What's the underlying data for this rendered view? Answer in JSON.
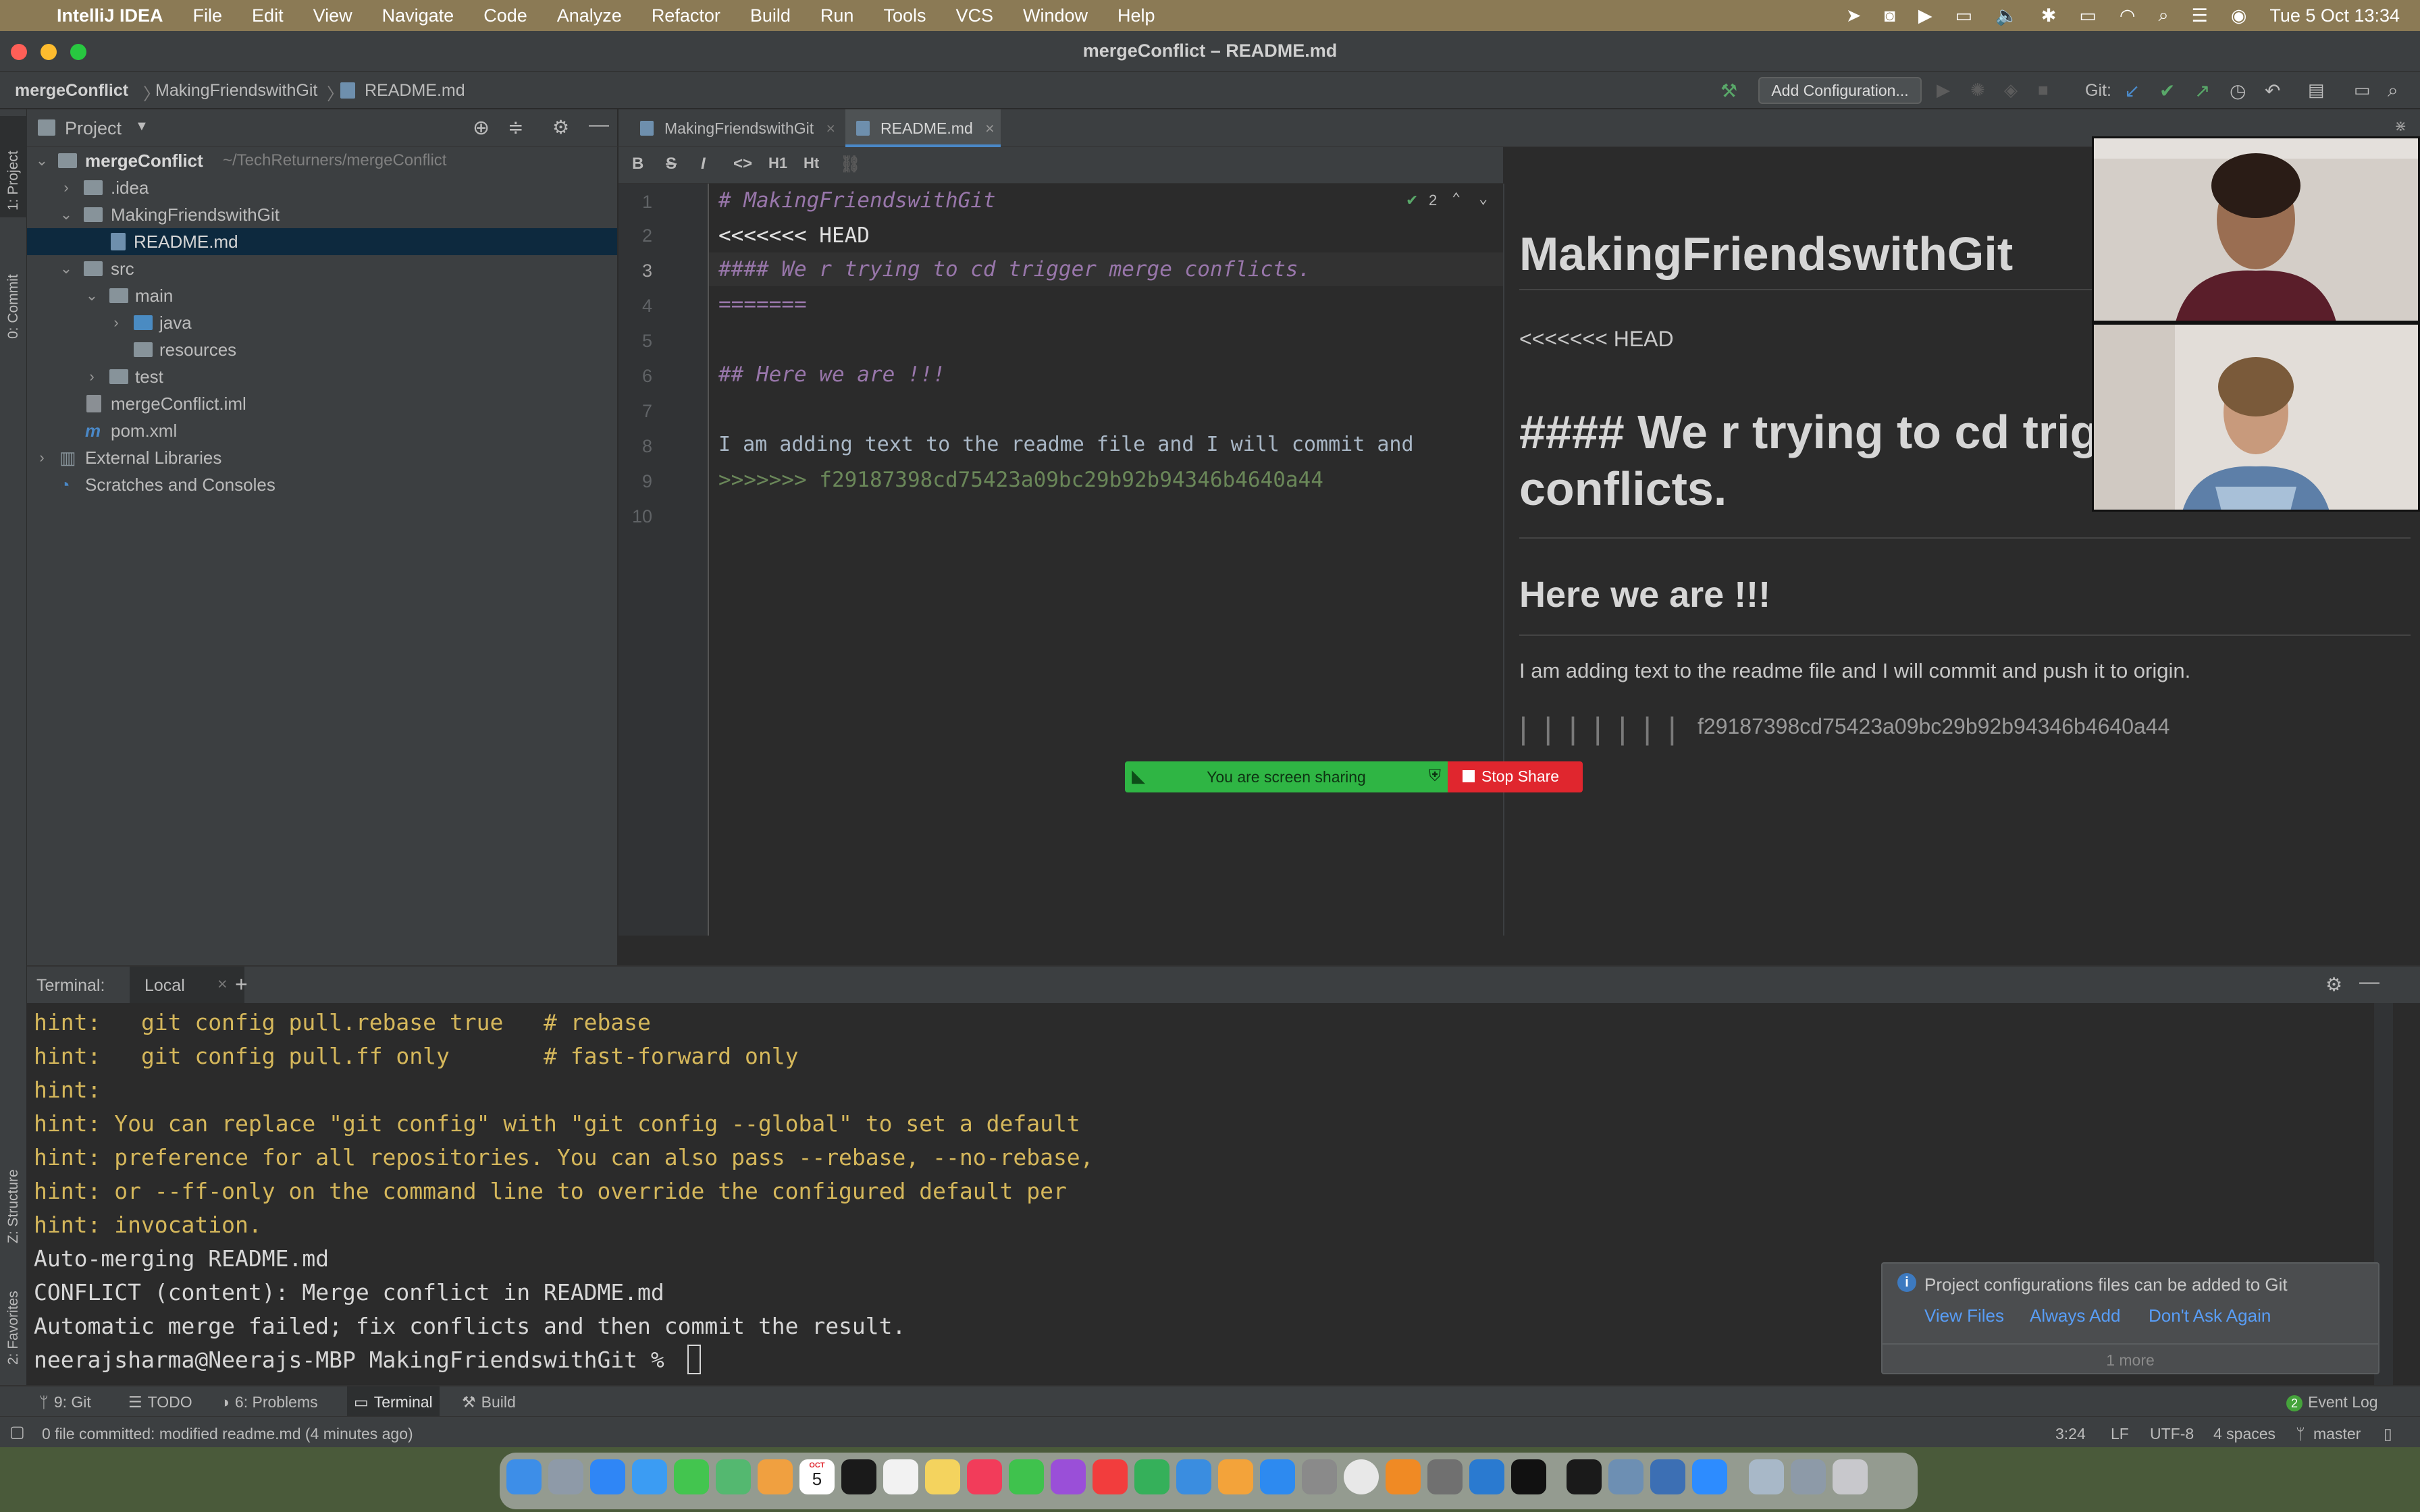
{
  "menubar": {
    "app_name": "IntelliJ IDEA",
    "items": [
      "File",
      "Edit",
      "View",
      "Navigate",
      "Code",
      "Analyze",
      "Refactor",
      "Build",
      "Run",
      "Tools",
      "VCS",
      "Window",
      "Help"
    ],
    "datetime": "Tue 5 Oct  13:34"
  },
  "window": {
    "title": "mergeConflict – README.md"
  },
  "navbar": {
    "breadcrumbs": [
      "mergeConflict",
      "MakingFriendswithGit",
      "README.md"
    ],
    "add_configuration": "Add Configuration...",
    "git_label": "Git:"
  },
  "left_stripe": {
    "project": "1: Project",
    "commit": "0: Commit",
    "structure": "Z: Structure",
    "favorites": "2: Favorites"
  },
  "project_panel": {
    "title": "Project",
    "tree": [
      {
        "label": "mergeConflict",
        "path": "~/TechReturners/mergeConflict"
      },
      {
        "label": ".idea"
      },
      {
        "label": "MakingFriendswithGit"
      },
      {
        "label": "README.md"
      },
      {
        "label": "src"
      },
      {
        "label": "main"
      },
      {
        "label": "java"
      },
      {
        "label": "resources"
      },
      {
        "label": "test"
      },
      {
        "label": "mergeConflict.iml"
      },
      {
        "label": "pom.xml"
      },
      {
        "label": "External Libraries"
      },
      {
        "label": "Scratches and Consoles"
      }
    ]
  },
  "editor": {
    "tabs": [
      {
        "label": "MakingFriendswithGit",
        "active": false
      },
      {
        "label": "README.md",
        "active": true
      }
    ],
    "toolbar": [
      "B",
      "S",
      "I",
      "<>",
      "H1",
      "Ht"
    ],
    "inspection_count": "2",
    "lines": [
      {
        "n": "1",
        "text": "# MakingFriendswithGit"
      },
      {
        "n": "2",
        "text": "<<<<<<< HEAD"
      },
      {
        "n": "3",
        "text": "#### We r trying to cd trigger merge conflicts."
      },
      {
        "n": "4",
        "text": "======="
      },
      {
        "n": "5",
        "text": ""
      },
      {
        "n": "6",
        "text": "## Here we are !!!"
      },
      {
        "n": "7",
        "text": ""
      },
      {
        "n": "8",
        "text": "I am adding text to the readme file and I will commit and"
      },
      {
        "n": "9",
        "text": ">>>>>>> f29187398cd75423a09bc29b92b94346b4640a44"
      },
      {
        "n": "10",
        "text": ""
      }
    ]
  },
  "preview": {
    "h1": "MakingFriendswithGit",
    "head_marker": "<<<<<<< HEAD",
    "h4_line1": "#### We r trying to cd trig",
    "h4_line2": "conflicts.",
    "h2": "Here we are !!!",
    "para": "I am adding text to the readme file and I will commit and push it to origin.",
    "marker_bars": "| | | | | | |",
    "hash": "f29187398cd75423a09bc29b92b94346b4640a44"
  },
  "screen_share": {
    "status": "You are screen sharing",
    "stop": "Stop Share"
  },
  "terminal": {
    "label": "Terminal:",
    "tab": "Local",
    "lines": [
      {
        "text": "hint:   git config pull.rebase true   # rebase",
        "style": "hint"
      },
      {
        "text": "hint:   git config pull.ff only       # fast-forward only",
        "style": "hint"
      },
      {
        "text": "hint:",
        "style": "hint"
      },
      {
        "text": "hint: You can replace \"git config\" with \"git config --global\" to set a default",
        "style": "hint"
      },
      {
        "text": "hint: preference for all repositories. You can also pass --rebase, --no-rebase,",
        "style": "hint"
      },
      {
        "text": "hint: or --ff-only on the command line to override the configured default per",
        "style": "hint"
      },
      {
        "text": "hint: invocation.",
        "style": "hint"
      },
      {
        "text": "Auto-merging README.md",
        "style": "out"
      },
      {
        "text": "CONFLICT (content): Merge conflict in README.md",
        "style": "out"
      },
      {
        "text": "Automatic merge failed; fix conflicts and then commit the result.",
        "style": "out"
      },
      {
        "text": "neerajsharma@Neerajs-MBP MakingFriendswithGit % ",
        "style": "out"
      }
    ]
  },
  "notification": {
    "message": "Project configurations files can be added to Git",
    "actions": [
      "View Files",
      "Always Add",
      "Don't Ask Again"
    ],
    "more": "1 more"
  },
  "bottom_tools": [
    "9: Git",
    "TODO",
    "6: Problems",
    "Terminal",
    "Build"
  ],
  "event_log": {
    "count": "2",
    "label": "Event Log"
  },
  "status": {
    "message": "0 file committed: modified readme.md (4 minutes ago)",
    "position": "3:24",
    "line_sep": "LF",
    "encoding": "UTF-8",
    "indent": "4 spaces",
    "branch": "master"
  },
  "dock": {
    "calendar_day": "5",
    "calendar_month": "OCT"
  },
  "colors": {
    "accent": "#4a88c7",
    "share_green": "#2fb544",
    "stop_red": "#e0262e"
  }
}
